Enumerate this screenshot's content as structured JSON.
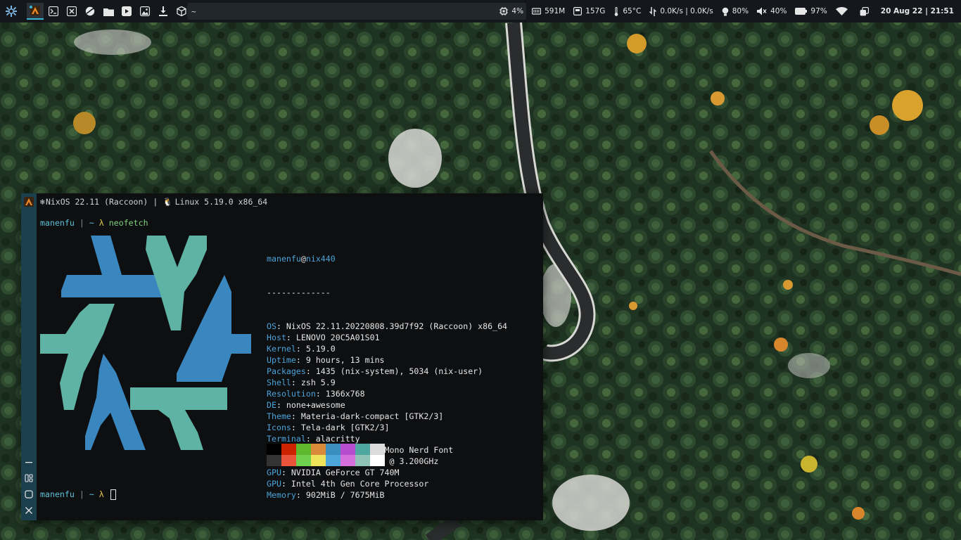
{
  "topbar": {
    "command_input": "~",
    "status": {
      "cpu": "4%",
      "memory": "591M",
      "disk": "157G",
      "temperature": "65°C",
      "network": "0.0K/s | 0.0K/s",
      "brightness": "80%",
      "volume": "40%",
      "battery": "97%",
      "datetime": "20 Aug 22 | 21:51"
    },
    "icons": [
      "nix-launcher-icon",
      "alacritty-icon",
      "terminal-icon",
      "vscode-icon",
      "browser-icon",
      "files-icon",
      "youtube-icon",
      "image-viewer-icon",
      "download-icon",
      "package-icon"
    ],
    "accent": "#39b6d6"
  },
  "terminal": {
    "title_os": "NixOS 22.11 (Raccoon)",
    "title_sep": "|",
    "title_kernel": "Linux 5.19.0 x86_64",
    "prompt_user": "manenfu",
    "prompt_sep": "|",
    "prompt_tilde": "~",
    "prompt_lambda": "λ",
    "command": "neofetch",
    "info_user": "manenfu",
    "info_at": "@",
    "info_host": "nix440",
    "info_rule": "-------------",
    "info": [
      {
        "key": "OS",
        "value": " NixOS 22.11.20220808.39d7f92 (Raccoon) x86_64"
      },
      {
        "key": "Host",
        "value": " LENOVO 20C5A01S01"
      },
      {
        "key": "Kernel",
        "value": " 5.19.0"
      },
      {
        "key": "Uptime",
        "value": " 9 hours, 13 mins"
      },
      {
        "key": "Packages",
        "value": " 1435 (nix-system), 5034 (nix-user)"
      },
      {
        "key": "Shell",
        "value": " zsh 5.9"
      },
      {
        "key": "Resolution",
        "value": " 1366x768"
      },
      {
        "key": "DE",
        "value": " none+awesome"
      },
      {
        "key": "Theme",
        "value": " Materia-dark-compact [GTK2/3]"
      },
      {
        "key": "Icons",
        "value": " Tela-dark [GTK2/3]"
      },
      {
        "key": "Terminal",
        "value": " alacritty"
      },
      {
        "key": "Terminal Font",
        "value": " JetBrainsMono Nerd Font"
      },
      {
        "key": "CPU",
        "value": " Intel i7-4702MQ (8) @ 3.200GHz"
      },
      {
        "key": "GPU",
        "value": " NVIDIA GeForce GT 740M"
      },
      {
        "key": "GPU",
        "value": " Intel 4th Gen Core Processor"
      },
      {
        "key": "Memory",
        "value": " 902MiB / 7675MiB"
      }
    ],
    "palette_top": [
      "#000000",
      "#cc2200",
      "#5fb82e",
      "#d98a3a",
      "#3a8fbf",
      "#b84ccf",
      "#4fa8a0",
      "#dcdcdc"
    ],
    "palette_bottom": [
      "#333333",
      "#e8533a",
      "#6fd04f",
      "#f0e35c",
      "#4da6d9",
      "#d66fdb",
      "#8fc3b8",
      "#ffffff"
    ],
    "logo_colors": {
      "blue": "#3a86bf",
      "teal": "#5fb3a5"
    },
    "colon": ":"
  }
}
